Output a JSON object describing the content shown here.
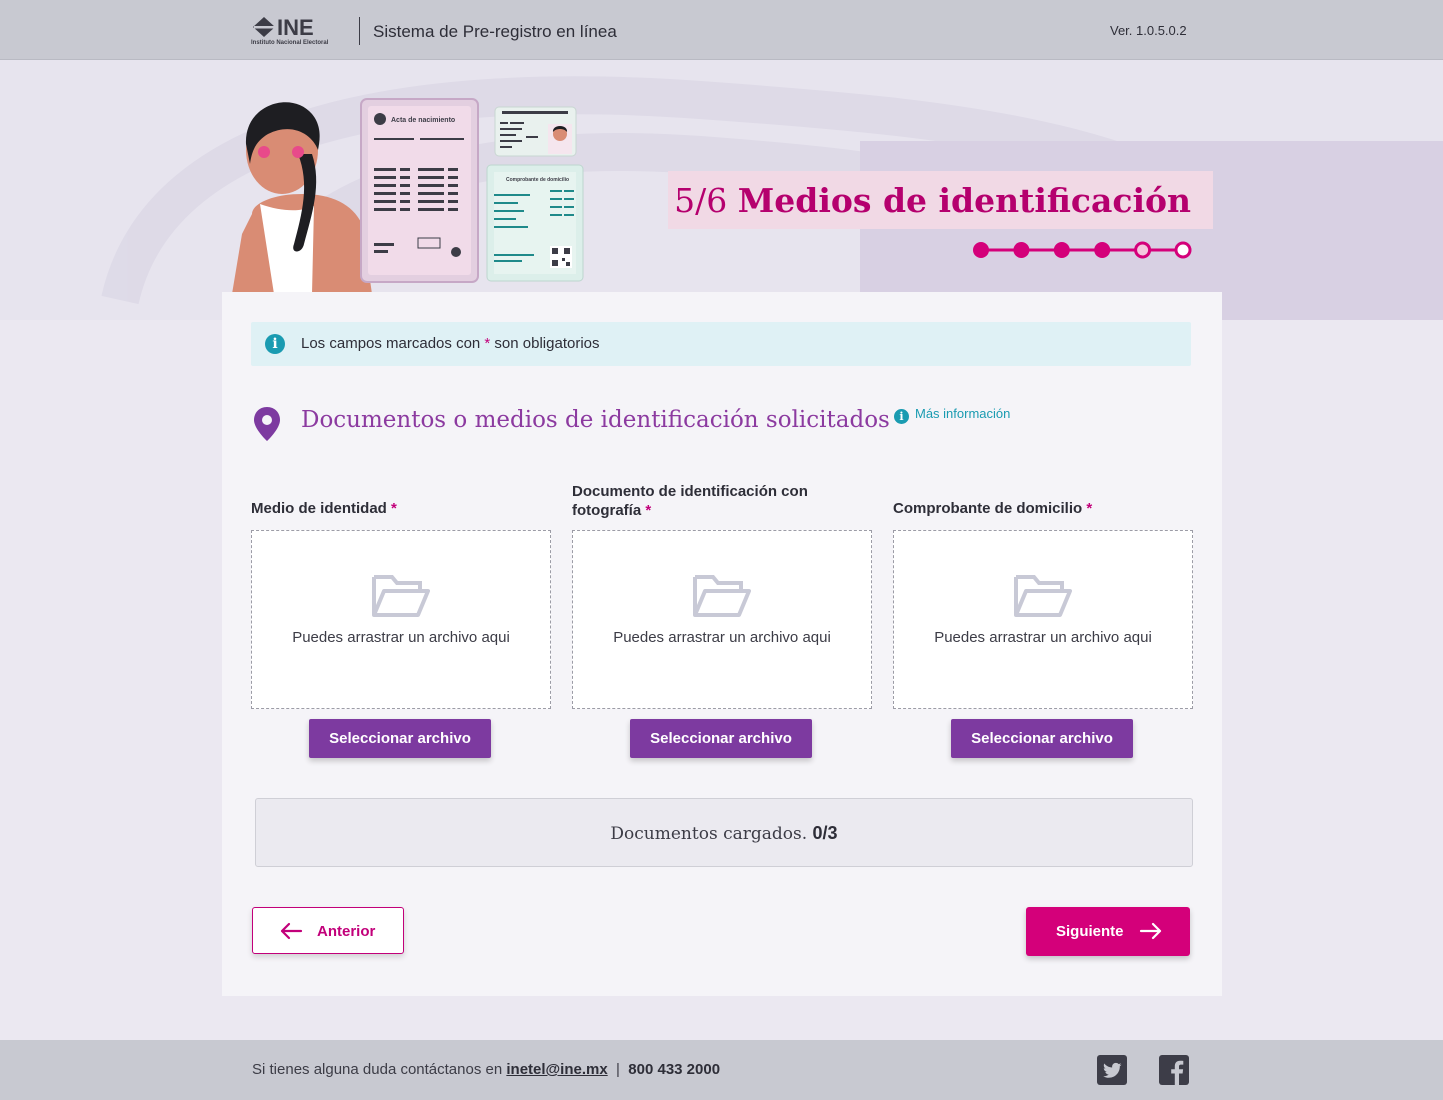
{
  "header": {
    "logo_text": "INE",
    "logo_subtext": "Instituto Nacional Electoral",
    "app_title": "Sistema de Pre-registro en línea",
    "version": "Ver. 1.0.5.0.2"
  },
  "hero": {
    "step_number": "5/6",
    "step_title": "Medios de identificación",
    "illustration": {
      "doc_title": "Acta de nacimiento",
      "proof_title": "Comprobante de domicilio"
    },
    "stepper": {
      "total": 6,
      "completed": 4,
      "current": 5
    }
  },
  "info": {
    "text_before": "Los campos marcados con ",
    "asterisk": "*",
    "text_after": " son obligatorios"
  },
  "section": {
    "title": "Documentos o medios de identificación solicitados",
    "more_info": "Más información"
  },
  "uploads": [
    {
      "label": "Medio de identidad",
      "required": "*",
      "drop_text": "Puedes arrastrar un archivo aqui",
      "button": "Seleccionar archivo"
    },
    {
      "label": "Documento de identificación con fotografía",
      "required": "*",
      "drop_text": "Puedes arrastrar un archivo aqui",
      "button": "Seleccionar archivo"
    },
    {
      "label": "Comprobante de domicilio",
      "required": "*",
      "drop_text": "Puedes arrastrar un archivo aqui",
      "button": "Seleccionar archivo"
    }
  ],
  "documents_loaded": {
    "label": "Documentos cargados.",
    "count": "0/3"
  },
  "nav": {
    "prev": "Anterior",
    "next": "Siguiente"
  },
  "footer": {
    "text": "Si tienes alguna duda contáctanos en ",
    "email": "inetel@ine.mx",
    "separator": "|",
    "phone": "800 433 2000"
  },
  "colors": {
    "accent_pink": "#d4007a",
    "accent_purple": "#7d3aa0",
    "info_teal": "#1a9bb1"
  }
}
